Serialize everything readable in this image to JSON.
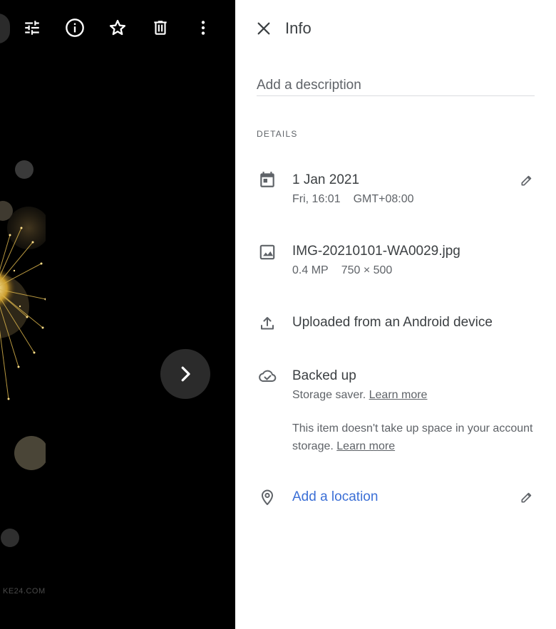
{
  "viewer": {
    "watermark": "KE24.COM"
  },
  "info_panel": {
    "title": "Info",
    "description_placeholder": "Add a description",
    "section_label": "DETAILS",
    "date": {
      "primary": "1 Jan 2021",
      "day_time": "Fri, 16:01",
      "timezone": "GMT+08:00"
    },
    "file": {
      "name": "IMG-20210101-WA0029.jpg",
      "megapixels": "0.4 MP",
      "dimensions": "750 × 500"
    },
    "upload": {
      "text": "Uploaded from an Android device"
    },
    "backup": {
      "status": "Backed up",
      "quality": "Storage saver.",
      "learn_more_1": "Learn more",
      "note": "This item doesn't take up space in your account storage.",
      "learn_more_2": "Learn more"
    },
    "location": {
      "add_label": "Add a location"
    }
  },
  "icons": [
    "edit-sliders-icon",
    "info-icon",
    "star-icon",
    "delete-icon",
    "more-vert-icon",
    "chevron-right-icon",
    "close-icon",
    "calendar-icon",
    "image-icon",
    "upload-icon",
    "cloud-done-icon",
    "location-pin-icon",
    "pencil-icon"
  ],
  "colors": {
    "viewer_bg": "#000000",
    "panel_bg": "#ffffff",
    "text": "#3c4043",
    "secondary_text": "#5f6368",
    "link_blue": "#3b6fd6",
    "divider": "#dadce0"
  }
}
